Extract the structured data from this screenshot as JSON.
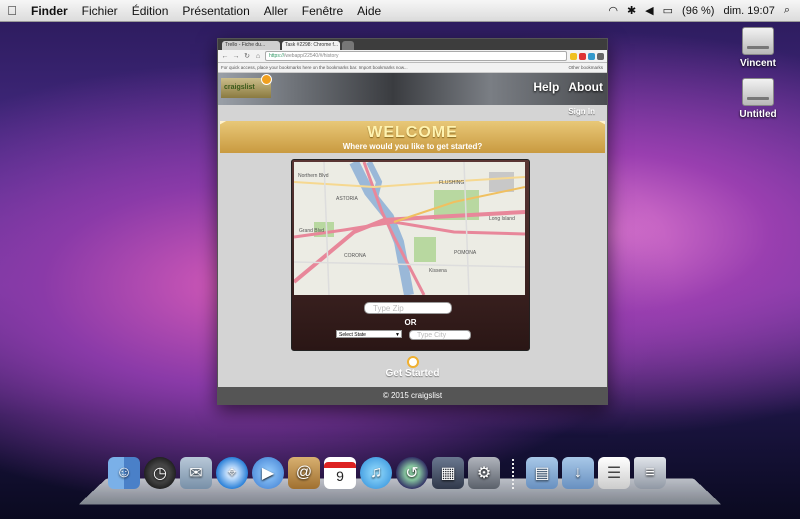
{
  "menubar": {
    "items": [
      "Finder",
      "Fichier",
      "Édition",
      "Présentation",
      "Aller",
      "Fenêtre",
      "Aide"
    ],
    "battery": "(96 %)",
    "clock": "dim. 19:07"
  },
  "desktop": {
    "icons": [
      {
        "label": "Vincent",
        "icon": "hard-drive-icon"
      },
      {
        "label": "Untitled",
        "icon": "hard-drive-icon"
      }
    ]
  },
  "browser": {
    "tabs": [
      {
        "label": "Trello - Fiche du..."
      },
      {
        "label": "Task #2298: Chrome f..."
      }
    ],
    "url": "https://",
    "url_tail": "/webapp/22540/#/history",
    "bookmarks_hint": "For quick access, place your bookmarks here on the bookmarks bar. Import bookmarks now...",
    "other_bookmarks": "Other bookmarks"
  },
  "page": {
    "logo": "craigslist",
    "nav": [
      "Help",
      "About"
    ],
    "signin": "Sign In",
    "welcome_title": "WELCOME",
    "welcome_subtitle": "Where would you like to get started?",
    "zip_placeholder": "Type Zip",
    "or": "OR",
    "state_select": "Select State",
    "city_placeholder": "Type City",
    "get_started": "Get Started",
    "footer": "© 2015 craigslist",
    "map_labels": [
      "Northern Blvd",
      "ASTORIA",
      "CORONA",
      "FLUSHING",
      "Long Island",
      "POMONA",
      "Grand Blvd",
      "Kissena"
    ]
  },
  "dock": {
    "icons": [
      "finder-icon",
      "dashboard-icon",
      "mail-icon",
      "safari-icon",
      "ichat-icon",
      "address-book-icon",
      "ical-icon",
      "itunes-icon",
      "time-machine-icon",
      "spaces-icon",
      "system-preferences-icon",
      "applications-folder-icon",
      "downloads-folder-icon",
      "preview-icon",
      "trash-icon"
    ],
    "ical_day": "9"
  }
}
